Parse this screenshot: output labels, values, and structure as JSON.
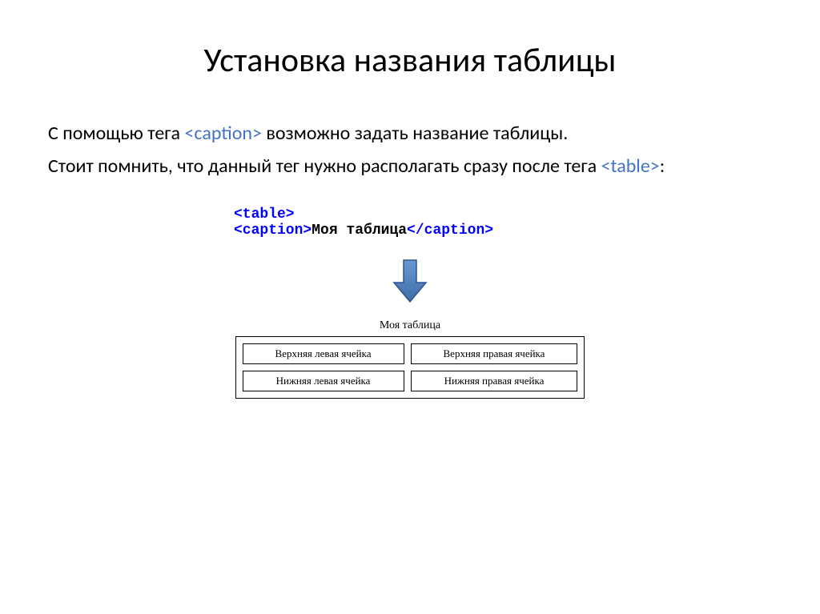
{
  "title": "Установка названия таблицы",
  "paragraph1": {
    "prefix": "С помощью тега ",
    "tag": "<caption>",
    "suffix": "  возможно задать название таблицы."
  },
  "paragraph2": {
    "prefix": "Стоит помнить, что данный тег нужно располагать сразу после тега ",
    "tag": "<table>",
    "suffix": ":"
  },
  "codeExample": {
    "line1": "<table>",
    "line2_open": "<caption>",
    "line2_content": "Моя таблица",
    "line2_close": "</caption>"
  },
  "tableExample": {
    "caption": "Моя таблица",
    "cells": {
      "topLeft": "Верхняя левая ячейка",
      "topRight": "Верхняя правая ячейка",
      "bottomLeft": "Нижняя левая ячейка",
      "bottomRight": "Нижняя правая ячейка"
    }
  }
}
